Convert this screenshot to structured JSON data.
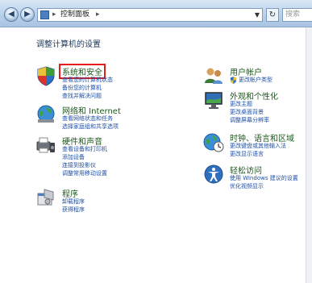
{
  "address": {
    "path": "控制面板",
    "search_placeholder": "搜索"
  },
  "page_title": "调整计算机的设置",
  "left_categories": [
    {
      "title": "系统和安全",
      "icon": "shield-icon",
      "links": [
        "查看您的计算机状态",
        "备份您的计算机",
        "查找并解决问题"
      ]
    },
    {
      "title": "网络和 Internet",
      "icon": "network-globe-icon",
      "links": [
        "查看网络状态和任务",
        "选择家庭组和共享选项"
      ]
    },
    {
      "title": "硬件和声音",
      "icon": "printer-speaker-icon",
      "links": [
        "查看设备和打印机",
        "添加设备",
        "连接到投影仪",
        "调整常用移动设置"
      ]
    },
    {
      "title": "程序",
      "icon": "programs-icon",
      "links": [
        "卸载程序",
        "获得程序"
      ]
    }
  ],
  "right_categories": [
    {
      "title": "用户帐户",
      "icon": "users-icon",
      "links": [
        "更改帐户类型"
      ]
    },
    {
      "title": "外观和个性化",
      "icon": "display-icon",
      "links": [
        "更改主题",
        "更改桌面背景",
        "调整屏幕分辨率"
      ]
    },
    {
      "title": "时钟、语言和区域",
      "icon": "clock-globe-icon",
      "links": [
        "更改键盘或其他输入法",
        "更改显示语言"
      ]
    },
    {
      "title": "轻松访问",
      "icon": "ease-of-access-icon",
      "links": [
        "使用 Windows 建议的设置",
        "优化视频显示"
      ]
    }
  ]
}
